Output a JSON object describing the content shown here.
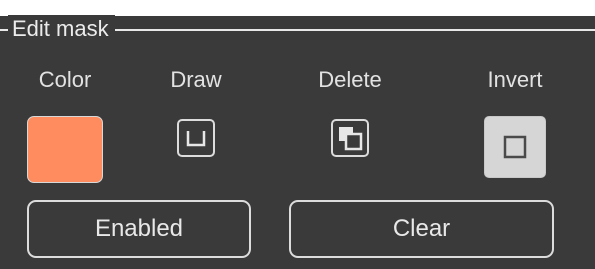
{
  "top_partial_text": "",
  "group": {
    "title": "Edit mask"
  },
  "tools": {
    "color": {
      "label": "Color",
      "value_color": "#ff8c5e"
    },
    "draw": {
      "label": "Draw",
      "icon": "draw-corner-icon"
    },
    "delete": {
      "label": "Delete",
      "icon": "delete-layers-icon"
    },
    "invert": {
      "label": "Invert",
      "icon": "invert-square-icon"
    }
  },
  "buttons": {
    "enabled": "Enabled",
    "clear": "Clear"
  },
  "colors": {
    "background": "#3a3a3a",
    "foreground": "#e2e2e2",
    "swatch": "#ff8c5e",
    "invert_fill": "#d6d6d6"
  }
}
